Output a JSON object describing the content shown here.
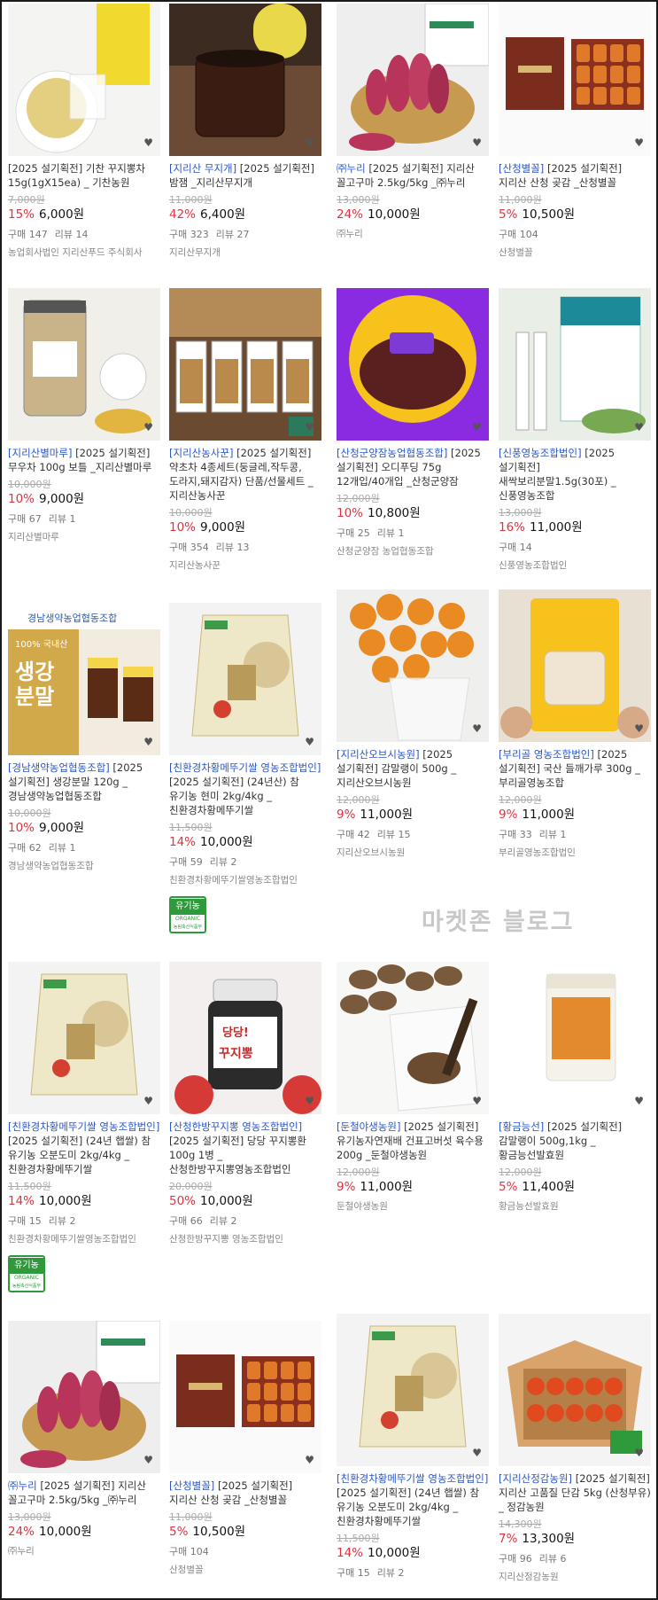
{
  "watermark": "마켓존 블로그",
  "badge": {
    "label": "유기농",
    "sub": "ORGANIC",
    "org": "농림축산식품부"
  },
  "heart_icon": "♥",
  "products": [
    {
      "store": "",
      "title": "[2025 설기획전] 기찬 꾸지뽕차 15g(1gX15ea) _ 기찬농원",
      "orig": "7,000원",
      "rate": "15%",
      "price": "6,000원",
      "buy": "구매 147",
      "review": "리뷰 14",
      "seller": "농업회사법인 지리산푸드 주식회사",
      "image": "tea-cup",
      "badge": false
    },
    {
      "store": "[지리산 무지개]",
      "title": " [2025 설기획전] 밤잼 _지리산무지개",
      "orig": "11,000원",
      "rate": "42%",
      "price": "6,400원",
      "buy": "구매 323",
      "review": "리뷰 27",
      "seller": "지리산무지개",
      "image": "jam-jar",
      "badge": false
    },
    {
      "store": "㈜누리",
      "title": " [2025 설기획전] 지리산 꼴고구마 2.5kg/5kg _㈜누리",
      "orig": "13,000원",
      "rate": "24%",
      "price": "10,000원",
      "buy": "",
      "review": "",
      "seller": "㈜누리",
      "image": "sweet-potato-basket",
      "badge": false
    },
    {
      "store": "[산청별꼴]",
      "title": " [2025 설기획전] 지리산 산청 곶감 _산청별꼴",
      "orig": "11,000원",
      "rate": "5%",
      "price": "10,500원",
      "buy": "구매 104",
      "review": "",
      "seller": "산청별꼴",
      "image": "persimmon-box",
      "badge": false
    },
    {
      "store": "[지리산별마루]",
      "title": " [2025 설기획전] 무우차 100g 보틀 _지리산별마루",
      "orig": "10,000원",
      "rate": "10%",
      "price": "9,000원",
      "buy": "구매 67",
      "review": "리뷰 1",
      "seller": "지리산별마루",
      "image": "radish-tea-bottle",
      "badge": false
    },
    {
      "store": "[지리산농사꾼]",
      "title": " [2025 설기획전] 약초차 4종세트(둥글레,작두콩,도라지,돼지감자) 단품/선물세트 _지리산농사꾼",
      "orig": "10,000원",
      "rate": "10%",
      "price": "9,000원",
      "buy": "구매 354",
      "review": "리뷰 13",
      "seller": "지리산농사꾼",
      "image": "herb-tea-set",
      "badge": false
    },
    {
      "store": "[산청군양잠농업협동조합]",
      "title": " [2025 설기획전] 오디푸딩 75g 12개입/40개입 _산청군양잠",
      "orig": "12,000원",
      "rate": "10%",
      "price": "10,800원",
      "buy": "구매 25",
      "review": "리뷰 1",
      "seller": "산청군양잠 농업협동조합",
      "image": "mulberry-pudding",
      "badge": false
    },
    {
      "store": "[신풍영농조합법인]",
      "title": " [2025 설기획전] 새싹보리분말1.5g(30포) _신풍영농조합",
      "orig": "13,000원",
      "rate": "16%",
      "price": "11,000원",
      "buy": "구매 14",
      "review": "",
      "seller": "신풍영농조합법인",
      "image": "barley-powder",
      "badge": false
    },
    {
      "store": "[경남생약농업협동조합]",
      "title": " [2025 설기획전] 생강분말 120g _경남생약농업협동조합",
      "orig": "10,000원",
      "rate": "10%",
      "price": "9,000원",
      "buy": "구매 62",
      "review": "리뷰 1",
      "seller": "경남생약농업협동조합",
      "image": "ginger-powder",
      "badge": false,
      "img_text": [
        "경남생약농업협동조합",
        "100% 국내산",
        "생강",
        "분말"
      ]
    },
    {
      "store": "[친환경차황메뚜기쌀 영농조합법인]",
      "title": " [2025 설기획전] (24년산) 참 유기농 현미 2kg/4kg _친환경차황메뚜기쌀",
      "orig": "11,500원",
      "rate": "14%",
      "price": "10,000원",
      "buy": "구매 59",
      "review": "리뷰 2",
      "seller": "친환경차황메뚜기쌀영농조합법인",
      "image": "rice-bag",
      "badge": true
    },
    {
      "store": "[지리산오브시농원]",
      "title": " [2025 설기획전] 감말랭이 500g _지리산오브시농원",
      "orig": "12,000원",
      "rate": "9%",
      "price": "11,000원",
      "buy": "구매 42",
      "review": "리뷰 15",
      "seller": "지리산오브시농원",
      "image": "dried-persimmon",
      "badge": false
    },
    {
      "store": "[부리골 영농조합법인]",
      "title": " [2025 설기획전] 국산 들깨가루 300g _부리골영농조합",
      "orig": "12,000원",
      "rate": "9%",
      "price": "11,000원",
      "buy": "구매 33",
      "review": "리뷰 1",
      "seller": "부리골영농조합법인",
      "image": "perilla-pouch",
      "badge": false
    },
    {
      "store": "[친환경차황메뚜기쌀 영농조합법인]",
      "title": " [2025 설기획전] (24년 햅쌀) 참 유기농 오분도미 2kg/4kg _친환경차황메뚜기쌀",
      "orig": "11,500원",
      "rate": "14%",
      "price": "10,000원",
      "buy": "구매 15",
      "review": "리뷰 2",
      "seller": "친환경차황메뚜기쌀영농조합법인",
      "image": "rice-bag",
      "badge": true
    },
    {
      "store": "[산청한방꾸지뽕 영농조합법인]",
      "title": " [2025 설기획전] 당당 꾸지뽕환 100g 1병 _산청한방꾸지뽕영농조합법인",
      "orig": "20,000원",
      "rate": "50%",
      "price": "10,000원",
      "buy": "구매 66",
      "review": "리뷰 2",
      "seller": "산청한방꾸지뽕 영농조합법인",
      "image": "kujibbong-jar",
      "badge": false,
      "img_text": [
        "당당!",
        "꾸지뽕"
      ]
    },
    {
      "store": "[둔철야생농원]",
      "title": " [2025 설기획전] 유기농자연재배 건표고버섯 육수용 200g _둔철야생농원",
      "orig": "12,000원",
      "rate": "9%",
      "price": "11,000원",
      "buy": "",
      "review": "",
      "seller": "둔철야생농원",
      "image": "shiitake",
      "badge": false
    },
    {
      "store": "[황금능선]",
      "title": " [2025 설기획전] 감말랭이 500g,1kg _황금능선발효원",
      "orig": "12,000원",
      "rate": "5%",
      "price": "11,400원",
      "buy": "",
      "review": "",
      "seller": "황금능선발효원",
      "image": "persimmon-pouch",
      "badge": false
    },
    {
      "store": "㈜누리",
      "title": " [2025 설기획전] 지리산 꼴고구마 2.5kg/5kg _㈜누리",
      "orig": "13,000원",
      "rate": "24%",
      "price": "10,000원",
      "buy": "",
      "review": "",
      "seller": "㈜누리",
      "image": "sweet-potato-basket",
      "badge": false
    },
    {
      "store": "[산청별꼴]",
      "title": " [2025 설기획전] 지리산 산청 곶감 _산청별꼴",
      "orig": "11,000원",
      "rate": "5%",
      "price": "10,500원",
      "buy": "구매 104",
      "review": "",
      "seller": "산청별꼴",
      "image": "persimmon-box",
      "badge": false
    },
    {
      "store": "[친환경차황메뚜기쌀 영농조합법인]",
      "title": " [2025 설기획전] (24년 햅쌀) 참 유기농 오분도미 2kg/4kg _친환경차황메뚜기쌀",
      "orig": "11,500원",
      "rate": "14%",
      "price": "10,000원",
      "buy": "구매 15",
      "review": "리뷰 2",
      "seller": "",
      "image": "rice-bag",
      "badge": false
    },
    {
      "store": "[지리산정감농원]",
      "title": " [2025 설기획전] 지리산 고품질 단감 5kg (산청부유) _ 정감농원",
      "orig": "14,300원",
      "rate": "7%",
      "price": "13,300원",
      "buy": "구매 96",
      "review": "리뷰 6",
      "seller": "지리산정감농원",
      "image": "persimmon-box-open",
      "badge": false
    }
  ]
}
